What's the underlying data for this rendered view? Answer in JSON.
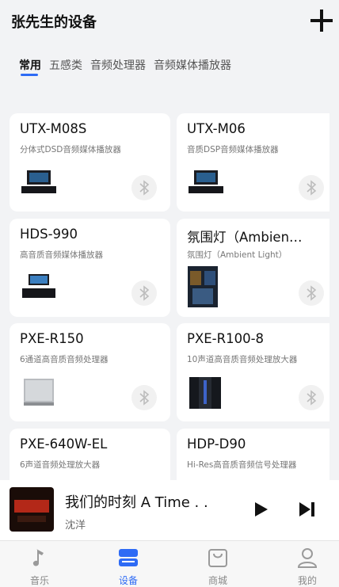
{
  "header": {
    "title": "张先生的设备",
    "add_icon": "plus-icon"
  },
  "tabs": [
    {
      "label": "常用",
      "active": true
    },
    {
      "label": "五感类",
      "active": false
    },
    {
      "label": "音频处理器",
      "active": false
    },
    {
      "label": "音频媒体播放器",
      "active": false
    }
  ],
  "devices": [
    {
      "name": "UTX-M08S",
      "desc": "分体式DSD音频媒体播放器"
    },
    {
      "name": "UTX-M06",
      "desc": "音质DSP音频媒体播放器"
    },
    {
      "name": "HDS-990",
      "desc": "高音质音频媒体播放器"
    },
    {
      "name": "氛围灯（Ambien…",
      "desc": "氛围灯（Ambient Light）"
    },
    {
      "name": "PXE-R150",
      "desc": "6通道高音质音频处理器"
    },
    {
      "name": "PXE-R100-8",
      "desc": "10声道高音质音频处理放大器"
    },
    {
      "name": "PXE-640W-EL",
      "desc": "6声道音频处理放大器"
    },
    {
      "name": "HDP-D90",
      "desc": "Hi-Res高音质音频信号处理器"
    }
  ],
  "player": {
    "song": "我们的时刻 A Time . .",
    "artist": "沈洋"
  },
  "nav": [
    {
      "label": "音乐",
      "icon": "music-note-icon",
      "active": false
    },
    {
      "label": "设备",
      "icon": "device-icon",
      "active": true
    },
    {
      "label": "商城",
      "icon": "shopping-bag-icon",
      "active": false
    },
    {
      "label": "我的",
      "icon": "person-icon",
      "active": false
    }
  ],
  "colors": {
    "accent": "#2e6bf5",
    "background": "#f2f3f5",
    "card": "#ffffff"
  }
}
